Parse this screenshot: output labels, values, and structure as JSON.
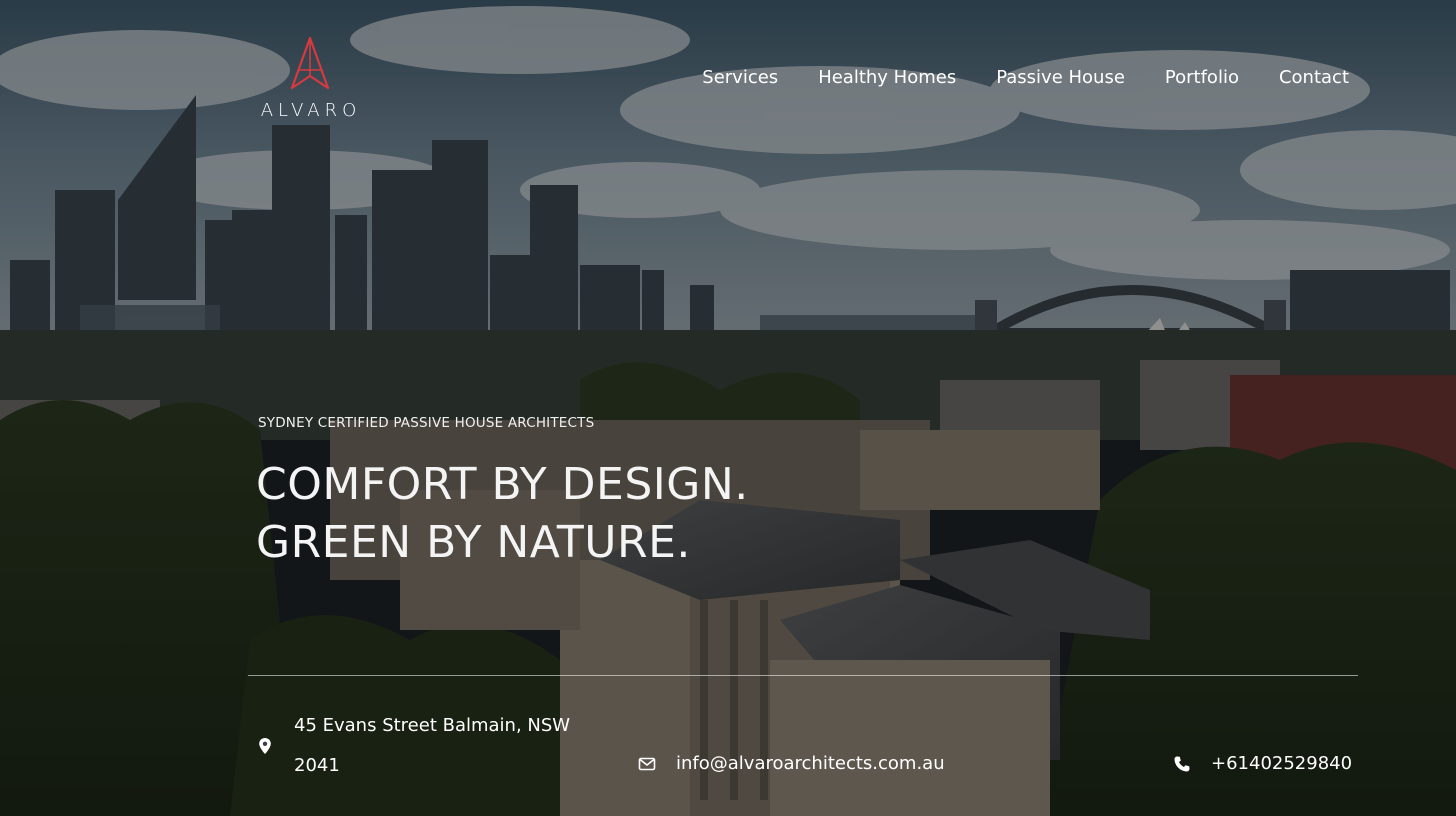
{
  "brand": {
    "name": "ALVARO",
    "accent_color": "#d63a3f"
  },
  "nav": {
    "items": [
      {
        "label": "Services"
      },
      {
        "label": "Healthy Homes"
      },
      {
        "label": "Passive House"
      },
      {
        "label": "Portfolio"
      },
      {
        "label": "Contact"
      }
    ]
  },
  "hero": {
    "eyebrow": "SYDNEY CERTIFIED PASSIVE HOUSE ARCHITECTS",
    "headline_line1": "COMFORT BY DESIGN.",
    "headline_line2": "GREEN BY NATURE."
  },
  "contact": {
    "address": "45 Evans Street Balmain, NSW 2041",
    "email": "info@alvaroarchitects.com.au",
    "phone": "+61402529840",
    "icons": {
      "address": "map-pin-icon",
      "email": "envelope-icon",
      "phone": "phone-icon"
    }
  }
}
